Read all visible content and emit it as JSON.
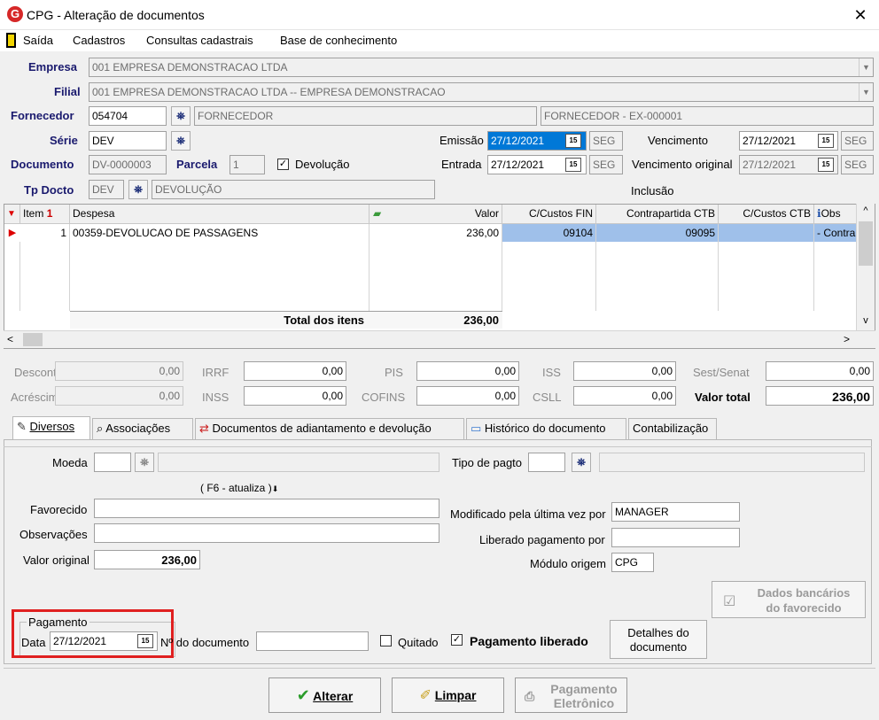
{
  "window": {
    "title": "CPG - Alteração de documentos",
    "close_glyph": "✕",
    "app_glyph": "G"
  },
  "menu": [
    "Saída",
    "Cadastros",
    "Consultas cadastrais",
    "Base de conhecimento"
  ],
  "header": {
    "empresa_label": "Empresa",
    "empresa_value": "001 EMPRESA DEMONSTRACAO LTDA",
    "filial_label": "Filial",
    "filial_value": "001 EMPRESA DEMONSTRACAO LTDA -- EMPRESA DEMONSTRACAO",
    "fornecedor_label": "Fornecedor",
    "fornecedor_code": "054704",
    "fornecedor_name": "FORNECEDOR",
    "fornecedor_ref": "FORNECEDOR - EX-000001",
    "serie_label": "Série",
    "serie_value": "DEV",
    "emissao_label": "Emissão",
    "emissao_value": "27/12/2021",
    "emissao_day": "SEG",
    "vencimento_label": "Vencimento",
    "vencimento_value": "27/12/2021",
    "vencimento_day": "SEG",
    "documento_label": "Documento",
    "documento_value": "DV-0000003",
    "parcela_label": "Parcela",
    "parcela_value": "1",
    "devolucao_label": "Devolução",
    "devolucao_checked": "✓",
    "entrada_label": "Entrada",
    "entrada_value": "27/12/2021",
    "entrada_day": "SEG",
    "venc_original_label": "Vencimento original",
    "venc_original_value": "27/12/2021",
    "venc_original_day": "SEG",
    "tpdocto_label": "Tp Docto",
    "tpdocto_code": "DEV",
    "tpdocto_name": "DEVOLUÇÃO",
    "inclusao_label": "Inclusão",
    "cal_glyph": "15"
  },
  "grid": {
    "columns": [
      "Item",
      "Despesa",
      "Valor",
      "C/Custos FIN",
      "Contrapartida CTB",
      "C/Custos CTB",
      "Obs"
    ],
    "rows": [
      {
        "item": "1",
        "despesa": "00359-DEVOLUCAO DE PASSAGENS",
        "valor": "236,00",
        "cc_fin": "09104",
        "contrapartida": "09095",
        "cc_ctb": "",
        "obs": "- Contra"
      }
    ],
    "total_label": "Total dos itens",
    "total_value": "236,00"
  },
  "totals": {
    "desconto_label": "Desconto",
    "desconto_value": "0,00",
    "irrf_label": "IRRF",
    "irrf_value": "0,00",
    "pis_label": "PIS",
    "pis_value": "0,00",
    "iss_label": "ISS",
    "iss_value": "0,00",
    "sest_label": "Sest/Senat",
    "sest_value": "0,00",
    "acrescimo_label": "Acréscimo",
    "acrescimo_value": "0,00",
    "inss_label": "INSS",
    "inss_value": "0,00",
    "cofins_label": "COFINS",
    "cofins_value": "0,00",
    "csll_label": "CSLL",
    "csll_value": "0,00",
    "valor_total_label": "Valor total",
    "valor_total_value": "236,00"
  },
  "tabs": [
    "Diversos",
    "Associações",
    "Documentos de adiantamento e devolução",
    "Histórico do documento",
    "Contabilização"
  ],
  "diversos": {
    "moeda_label": "Moeda",
    "tipo_pagto_label": "Tipo de pagto",
    "f6_hint": "( F6 - atualiza )",
    "favorecido_label": "Favorecido",
    "observacoes_label": "Observações",
    "valor_original_label": "Valor original",
    "valor_original_value": "236,00",
    "modificado_label": "Modificado pela última vez por",
    "modificado_value": "MANAGER",
    "liberado_label": "Liberado pagamento por",
    "liberado_value": "",
    "modulo_label": "Módulo origem",
    "modulo_value": "CPG",
    "dados_bancarios_line1": "Dados bancários",
    "dados_bancarios_line2": "do favorecido",
    "pagamento_group": "Pagamento",
    "data_label": "Data",
    "data_value": "27/12/2021",
    "ndoc_label": "Nº do documento",
    "quitado_label": "Quitado",
    "pag_liberado_label": "Pagamento liberado",
    "pag_liberado_checked": "✓",
    "detalhes_line1": "Detalhes do",
    "detalhes_line2": "documento"
  },
  "footer": {
    "alterar_label": "Alterar",
    "limpar_label": "Limpar",
    "pag_eletronico_line1": "Pagamento",
    "pag_eletronico_line2": "Eletrônico"
  },
  "icons": {
    "binoculars": "⛯",
    "scroll_left": "<",
    "scroll_right": ">",
    "scroll_up": "^",
    "scroll_down": "v",
    "combo_down": "▼",
    "sort_icon": "1",
    "row_marker": "▶"
  }
}
